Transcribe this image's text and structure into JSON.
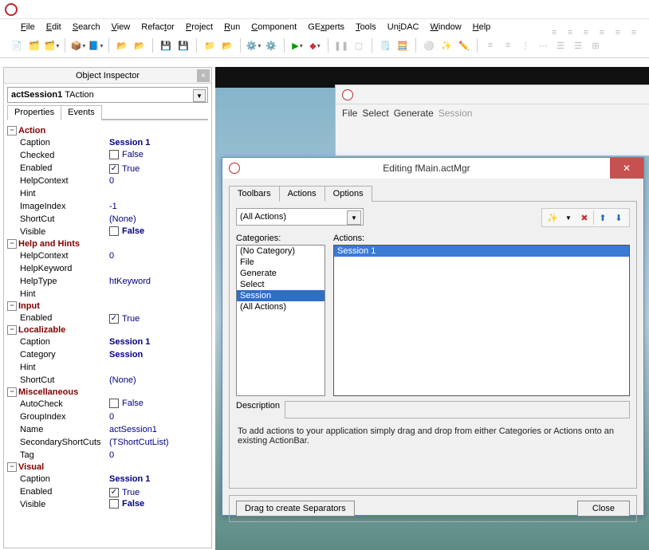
{
  "app_menu": [
    "File",
    "Edit",
    "Search",
    "View",
    "Refactor",
    "Project",
    "Run",
    "Component",
    "GExperts",
    "Tools",
    "UniDAC",
    "Window",
    "Help"
  ],
  "object_inspector": {
    "title": "Object Inspector",
    "selected_name": "actSession1",
    "selected_class": "TAction",
    "tabs": [
      "Properties",
      "Events"
    ],
    "active_tab": 0,
    "categories": [
      {
        "name": "Action",
        "rows": [
          {
            "prop": "Caption",
            "val": "Session 1",
            "bold": true
          },
          {
            "prop": "Checked",
            "val": "False",
            "check": false
          },
          {
            "prop": "Enabled",
            "val": "True",
            "check": true
          },
          {
            "prop": "HelpContext",
            "val": "0"
          },
          {
            "prop": "Hint",
            "val": ""
          },
          {
            "prop": "ImageIndex",
            "val": "-1"
          },
          {
            "prop": "ShortCut",
            "val": "(None)"
          },
          {
            "prop": "Visible",
            "val": "False",
            "check": false,
            "bold": true
          }
        ]
      },
      {
        "name": "Help and Hints",
        "rows": [
          {
            "prop": "HelpContext",
            "val": "0"
          },
          {
            "prop": "HelpKeyword",
            "val": ""
          },
          {
            "prop": "HelpType",
            "val": "htKeyword"
          },
          {
            "prop": "Hint",
            "val": ""
          }
        ]
      },
      {
        "name": "Input",
        "rows": [
          {
            "prop": "Enabled",
            "val": "True",
            "check": true
          }
        ]
      },
      {
        "name": "Localizable",
        "rows": [
          {
            "prop": "Caption",
            "val": "Session 1",
            "bold": true
          },
          {
            "prop": "Category",
            "val": "Session",
            "bold": true
          },
          {
            "prop": "Hint",
            "val": ""
          },
          {
            "prop": "ShortCut",
            "val": "(None)"
          }
        ]
      },
      {
        "name": "Miscellaneous",
        "rows": [
          {
            "prop": "AutoCheck",
            "val": "False",
            "check": false
          },
          {
            "prop": "GroupIndex",
            "val": "0"
          },
          {
            "prop": "Name",
            "val": "actSession1"
          },
          {
            "prop": "SecondaryShortCuts",
            "val": "(TShortCutList)"
          },
          {
            "prop": "Tag",
            "val": "0"
          }
        ]
      },
      {
        "name": "Visual",
        "rows": [
          {
            "prop": "Caption",
            "val": "Session 1",
            "bold": true
          },
          {
            "prop": "Enabled",
            "val": "True",
            "check": true
          },
          {
            "prop": "Visible",
            "val": "False",
            "check": false,
            "bold": true
          }
        ]
      }
    ]
  },
  "editor": {
    "menu": [
      "File",
      "Select",
      "Generate",
      "Session"
    ],
    "disabled_index": 3
  },
  "dialog": {
    "title": "Editing fMain.actMgr",
    "tabs": [
      "Toolbars",
      "Actions",
      "Options"
    ],
    "active_tab": 1,
    "filter": "(All Actions)",
    "cat_label": "Categories:",
    "act_label": "Actions:",
    "categories": [
      "(No Category)",
      "File",
      "Generate",
      "Select",
      "Session",
      "(All Actions)"
    ],
    "selected_category": 4,
    "actions": [
      "Session 1"
    ],
    "selected_action": 0,
    "description_label": "Description",
    "hint": "To add actions to your application simply drag and drop from either Categories or Actions onto an existing ActionBar.",
    "drag_label": "Drag to create Separators",
    "close": "Close",
    "tool_icons": [
      "new-action",
      "delete-action",
      "move-up",
      "move-down"
    ]
  }
}
